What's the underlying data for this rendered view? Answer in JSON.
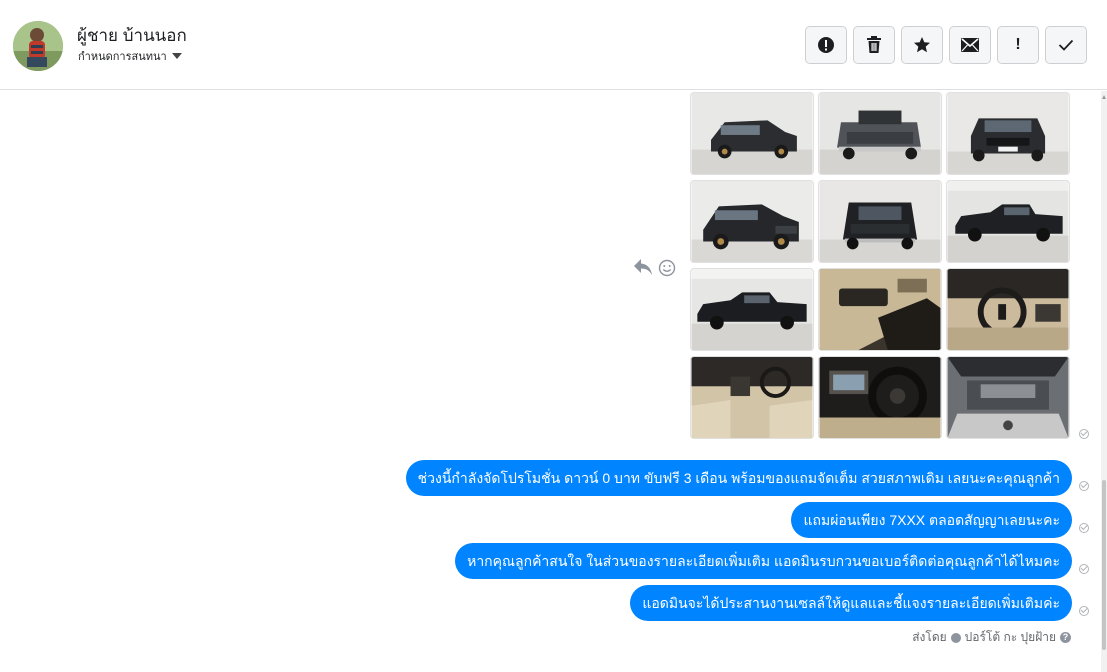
{
  "header": {
    "contact_name": "ผู้ชาย บ้านนอก",
    "subtitle": "กำหนดการสนทนา",
    "avatar_icon": "profile-photo"
  },
  "toolbar": {
    "buttons": [
      {
        "name": "alert-circle-icon",
        "label": ""
      },
      {
        "name": "trash-icon",
        "label": ""
      },
      {
        "name": "star-icon",
        "label": ""
      },
      {
        "name": "envelope-icon",
        "label": ""
      },
      {
        "name": "exclamation-icon",
        "label": "!"
      },
      {
        "name": "checkmark-icon",
        "label": ""
      }
    ]
  },
  "photos": {
    "count": 12,
    "subjects": [
      "truck-front-left",
      "truck-rear",
      "truck-front",
      "truck-front-left-angle",
      "truck-rear-high",
      "truck-side",
      "truck-side-2",
      "interior-door",
      "interior-steering",
      "interior-dashboard",
      "interior-console",
      "engine-bay"
    ]
  },
  "messages": [
    "ช่วงนี้กำลังจัดโปรโมชั่น ดาวน์ 0 บาท ขับฟรี 3 เดือน พร้อมของแถมจัดเต็ม สวยสภาพเดิม เลยนะคะคุณลูกค้า",
    "แถมผ่อนเพียง 7XXX ตลอดสัญญาเลยนะคะ",
    "หากคุณลูกค้าสนใจ ในส่วนของรายละเอียดเพิ่มเติม แอดมินรบกวนขอเบอร์ติดต่อคุณลูกค้าได้ไหมคะ",
    "แอดมินจะได้ประสานงานเซลล์ให้ดูแลและชี้แจงรายละเอียดเพิ่มเติมค่ะ"
  ],
  "footer": {
    "sent_by_label": "ส่งโดย",
    "sender_name": "ปอร์โต้ กะ ปุยฝ้าย",
    "help_label": "?"
  },
  "colors": {
    "bubble": "#0084ff",
    "border": "#dddfe2"
  }
}
